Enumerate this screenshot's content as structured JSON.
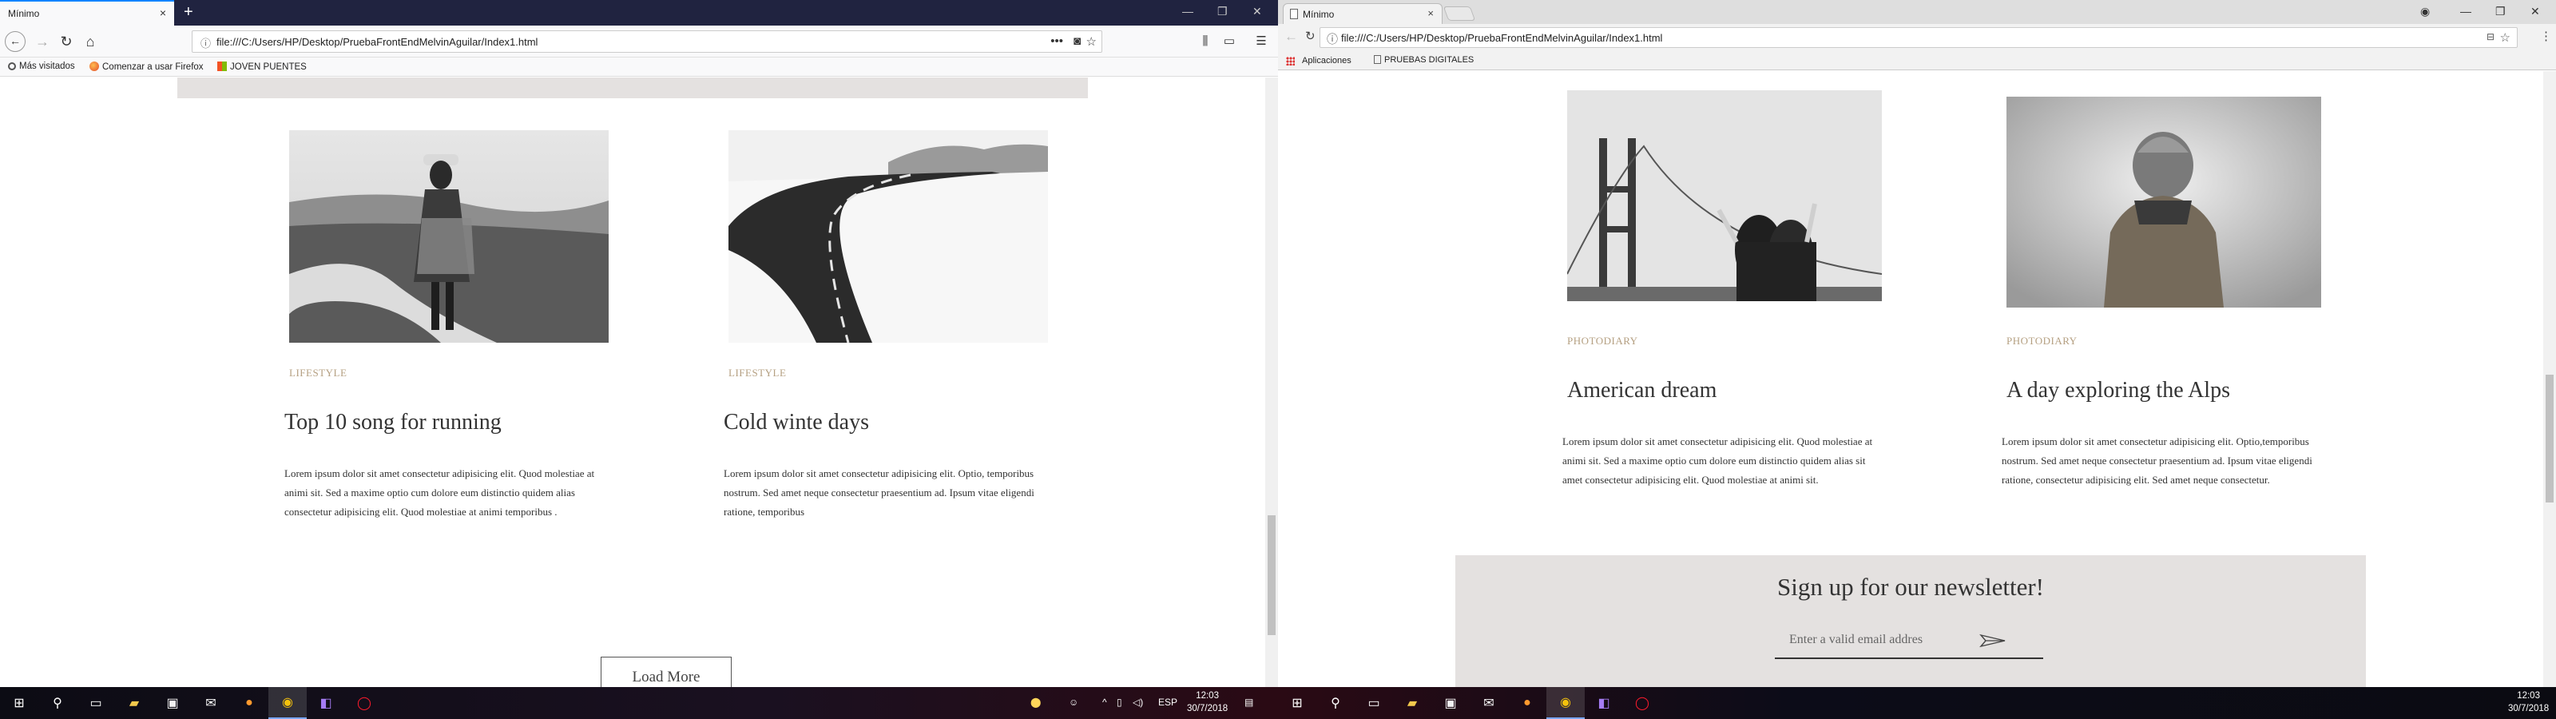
{
  "firefox": {
    "tab_title": "Mínimo",
    "url": "file:///C:/Users/HP/Desktop/PruebaFrontEndMelvinAguilar/Index1.html",
    "bookmarks": [
      "Más visitados",
      "Comenzar a usar Firefox",
      "JOVEN PUENTES"
    ]
  },
  "chrome": {
    "tab_title": "Mínimo",
    "url": "file:///C:/Users/HP/Desktop/PruebaFrontEndMelvinAguilar/Index1.html",
    "bookmarks": [
      "Aplicaciones",
      "PRUEBAS DIGITALES"
    ]
  },
  "left_page": {
    "posts": [
      {
        "category": "LIFESTYLE",
        "title": "Top 10 song for running",
        "excerpt_lines": [
          "Lorem ipsum dolor sit amet consectetur adipisicing elit. Quod molestiae at",
          "animi sit. Sed a maxime optio cum dolore eum distinctio quidem alias",
          "consectetur adipisicing elit. Quod molestiae at animi temporibus ."
        ]
      },
      {
        "category": "LIFESTYLE",
        "title": "Cold winte days",
        "excerpt_lines": [
          "Lorem ipsum dolor sit amet consectetur adipisicing elit. Optio, temporibus",
          "nostrum. Sed amet neque consectetur praesentium ad. Ipsum vitae eligendi",
          "ratione, temporibus"
        ]
      }
    ],
    "load_more_label": "Load More"
  },
  "right_page": {
    "posts": [
      {
        "category": "PHOTODIARY",
        "title": "American dream",
        "excerpt_lines": [
          "Lorem ipsum dolor sit amet consectetur adipisicing elit. Quod molestiae at",
          "animi sit. Sed a maxime optio cum dolore eum distinctio quidem alias sit",
          "amet consectetur adipisicing elit. Quod molestiae at animi sit."
        ]
      },
      {
        "category": "PHOTODIARY",
        "title": "A day exploring the Alps",
        "excerpt_lines": [
          "Lorem ipsum dolor sit amet consectetur adipisicing elit. Optio,temporibus",
          "nostrum. Sed amet neque consectetur praesentium ad. Ipsum vitae eligendi",
          "ratione, consectetur adipisicing elit. Sed amet neque consectetur."
        ]
      }
    ],
    "newsletter": {
      "title": "Sign up for our newsletter!",
      "placeholder": "Enter a valid email addres"
    }
  },
  "taskbar": {
    "left_lang": "ESP",
    "left_time": "12:03",
    "left_date": "30/7/2018",
    "right_time": "12:03",
    "right_date": "30/7/2018"
  },
  "colors": {
    "category": "#b5a082",
    "newsletter_bg": "#e4e1e0",
    "firefox_tabstrip": "#202340",
    "firefox_accent": "#0a84ff"
  }
}
